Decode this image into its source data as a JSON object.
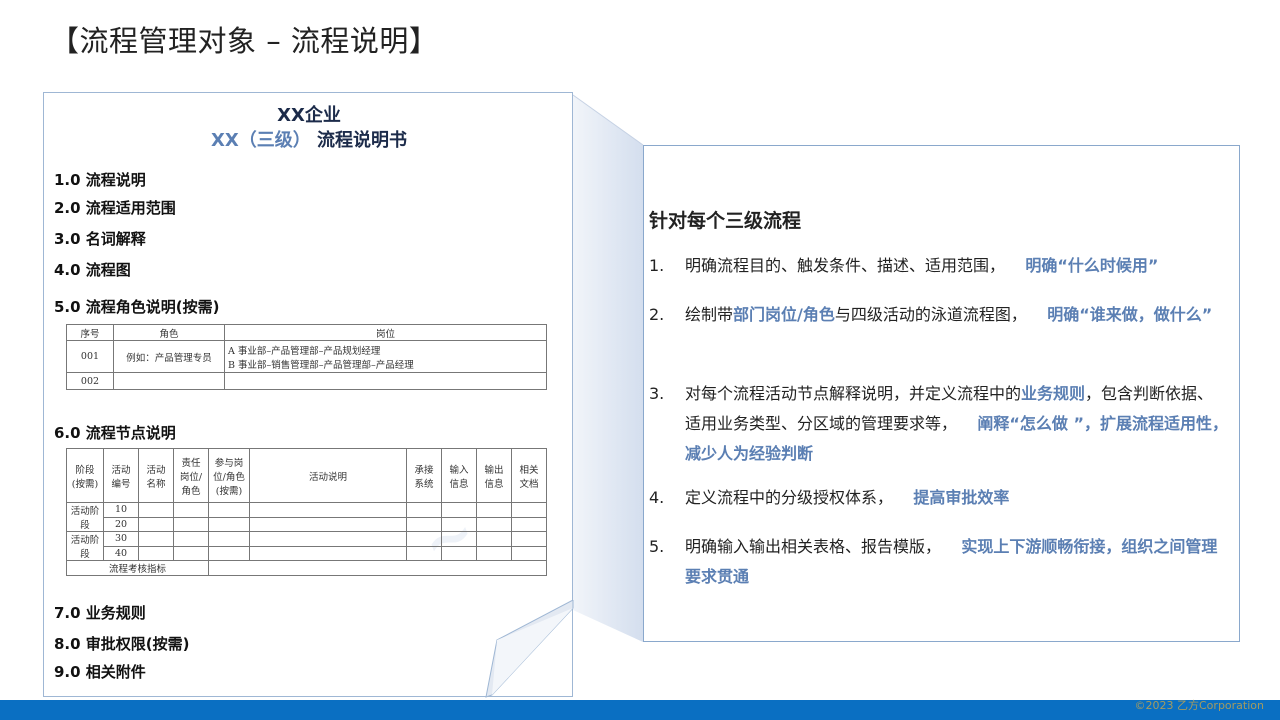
{
  "title": "【流程管理对象 – 流程说明】",
  "document": {
    "company": "XX企业",
    "subtitle_accent": "XX（三级）",
    "subtitle_rest": " 流程说明书",
    "sections": {
      "s1": "1.0  流程说明",
      "s2": "2.0  流程适用范围",
      "s3": "3.0  名词解释",
      "s4": "4.0  流程图",
      "s5": "5.0  流程角色说明(按需)",
      "s6": "6.0  流程节点说明",
      "s7": "7.0  业务规则",
      "s8": "8.0  审批权限(按需)",
      "s9": "9.0  相关附件"
    },
    "role_table": {
      "headers": [
        "序号",
        "角色",
        "岗位"
      ],
      "rows": [
        {
          "no": "001",
          "role": "例如：产品管理专员",
          "post_a": "A 事业部–产品管理部–产品规划经理",
          "post_b": "B 事业部–销售管理部–产品管理部–产品经理"
        },
        {
          "no": "002",
          "role": "",
          "post_a": "",
          "post_b": ""
        }
      ]
    },
    "node_table": {
      "headers": [
        "阶段(按需)",
        "活动编号",
        "活动名称",
        "责任岗位/角色",
        "参与岗位/角色(按需)",
        "活动说明",
        "承接系统",
        "输入信息",
        "输出信息",
        "相关文档"
      ],
      "stages": [
        "活动阶段",
        "活动阶段"
      ],
      "numbers": [
        "10",
        "20",
        "30",
        "40"
      ],
      "kpi_label": "流程考核指标"
    }
  },
  "panel": {
    "heading": "针对每个三级流程",
    "items": [
      {
        "num": "1.",
        "text": "明确流程目的、触发条件、描述、适用范围，",
        "highlight": "明确“什么时候用”"
      },
      {
        "num": "2.",
        "pre": "绘制带",
        "mid_hl": "部门岗位/角色",
        "post": "与四级活动的泳道流程图，",
        "highlight": "明确“谁来做，做什么”"
      },
      {
        "num": "3.",
        "pre": "对每个流程活动节点解释说明，并定义流程中的",
        "mid_hl": "业务规则",
        "post": "，包含判断依据、适用业务类型、分区域的管理要求等，",
        "highlight": "阐释“怎么做 ”，扩展流程适用性，减少人为经验判断"
      },
      {
        "num": "4.",
        "text": "定义流程中的分级授权体系，",
        "highlight": "提高审批效率"
      },
      {
        "num": "5.",
        "text": "明确输入输出相关表格、报告模版，",
        "highlight": "实现上下游顺畅衔接，组织之间管理要求贯通"
      }
    ]
  },
  "footer": {
    "copyright": "©2023 乙方Corporation"
  },
  "colors": {
    "accent": "#5b7fb3",
    "footer": "#0a6fc2",
    "panel_border": "#8aa8cc"
  }
}
